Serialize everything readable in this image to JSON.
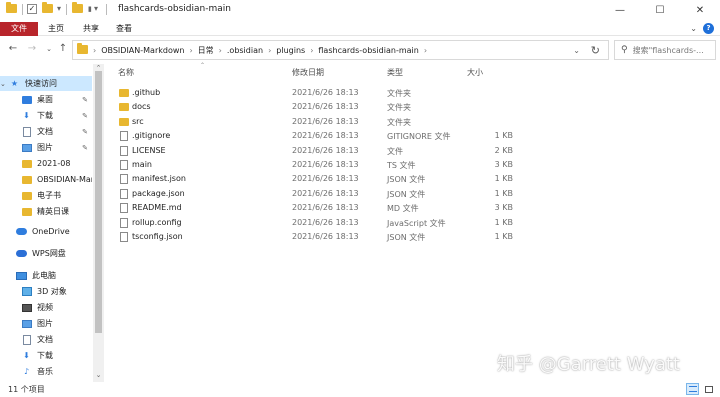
{
  "window": {
    "title": "flashcards-obsidian-main",
    "minimize_label": "—",
    "maximize_label": "☐",
    "close_label": "✕"
  },
  "ribbon": {
    "tabs": [
      {
        "label": "文件",
        "active": true
      },
      {
        "label": "主页"
      },
      {
        "label": "共享"
      },
      {
        "label": "查看"
      }
    ]
  },
  "address": {
    "breadcrumbs": [
      "OBSIDIAN-Markdown",
      "日常",
      ".obsidian",
      "plugins",
      "flashcards-obsidian-main"
    ]
  },
  "search": {
    "placeholder": "搜索\"flashcards-..."
  },
  "sidebar": {
    "items": [
      {
        "label": "快速访问",
        "icon": "star-icon",
        "pinned": false
      },
      {
        "label": "桌面",
        "icon": "desktop-icon",
        "pinned": true
      },
      {
        "label": "下载",
        "icon": "download-icon",
        "pinned": true
      },
      {
        "label": "文档",
        "icon": "document-icon",
        "pinned": true
      },
      {
        "label": "图片",
        "icon": "picture-icon",
        "pinned": true
      },
      {
        "label": "2021-08",
        "icon": "folder-icon",
        "pinned": false
      },
      {
        "label": "OBSIDIAN-Mar",
        "icon": "folder-icon",
        "pinned": false
      },
      {
        "label": "电子书",
        "icon": "folder-icon",
        "pinned": false
      },
      {
        "label": "精英日课",
        "icon": "folder-icon",
        "pinned": false
      },
      {
        "label": "OneDrive",
        "icon": "cloud-icon",
        "pinned": false
      },
      {
        "label": "WPS网盘",
        "icon": "wps-cloud-icon",
        "pinned": false
      },
      {
        "label": "此电脑",
        "icon": "computer-icon",
        "pinned": false
      },
      {
        "label": "3D 对象",
        "icon": "3d-objects-icon",
        "pinned": false
      },
      {
        "label": "视频",
        "icon": "video-icon",
        "pinned": false
      },
      {
        "label": "图片",
        "icon": "picture-icon",
        "pinned": false
      },
      {
        "label": "文档",
        "icon": "document-icon",
        "pinned": false
      },
      {
        "label": "下载",
        "icon": "download-icon",
        "pinned": false
      },
      {
        "label": "音乐",
        "icon": "music-icon",
        "pinned": false
      }
    ]
  },
  "columns": {
    "name": "名称",
    "date": "修改日期",
    "type": "类型",
    "size": "大小"
  },
  "files": [
    {
      "name": ".github",
      "date": "2021/6/26 18:13",
      "type": "文件夹",
      "size": "",
      "kind": "folder"
    },
    {
      "name": "docs",
      "date": "2021/6/26 18:13",
      "type": "文件夹",
      "size": "",
      "kind": "folder"
    },
    {
      "name": "src",
      "date": "2021/6/26 18:13",
      "type": "文件夹",
      "size": "",
      "kind": "folder"
    },
    {
      "name": ".gitignore",
      "date": "2021/6/26 18:13",
      "type": "GITIGNORE 文件",
      "size": "1 KB",
      "kind": "file"
    },
    {
      "name": "LICENSE",
      "date": "2021/6/26 18:13",
      "type": "文件",
      "size": "2 KB",
      "kind": "file"
    },
    {
      "name": "main",
      "date": "2021/6/26 18:13",
      "type": "TS 文件",
      "size": "3 KB",
      "kind": "file"
    },
    {
      "name": "manifest.json",
      "date": "2021/6/26 18:13",
      "type": "JSON 文件",
      "size": "1 KB",
      "kind": "file"
    },
    {
      "name": "package.json",
      "date": "2021/6/26 18:13",
      "type": "JSON 文件",
      "size": "1 KB",
      "kind": "file"
    },
    {
      "name": "README.md",
      "date": "2021/6/26 18:13",
      "type": "MD 文件",
      "size": "3 KB",
      "kind": "file"
    },
    {
      "name": "rollup.config",
      "date": "2021/6/26 18:13",
      "type": "JavaScript 文件",
      "size": "1 KB",
      "kind": "file"
    },
    {
      "name": "tsconfig.json",
      "date": "2021/6/26 18:13",
      "type": "JSON 文件",
      "size": "1 KB",
      "kind": "file"
    }
  ],
  "status": {
    "item_count": "11 个项目"
  },
  "watermark": "知乎 @Garrett Wyatt",
  "colors": {
    "file_tab": "#b8252b",
    "selection": "#cce8ff",
    "folder": "#e8b730",
    "accent": "#2f7dde"
  }
}
